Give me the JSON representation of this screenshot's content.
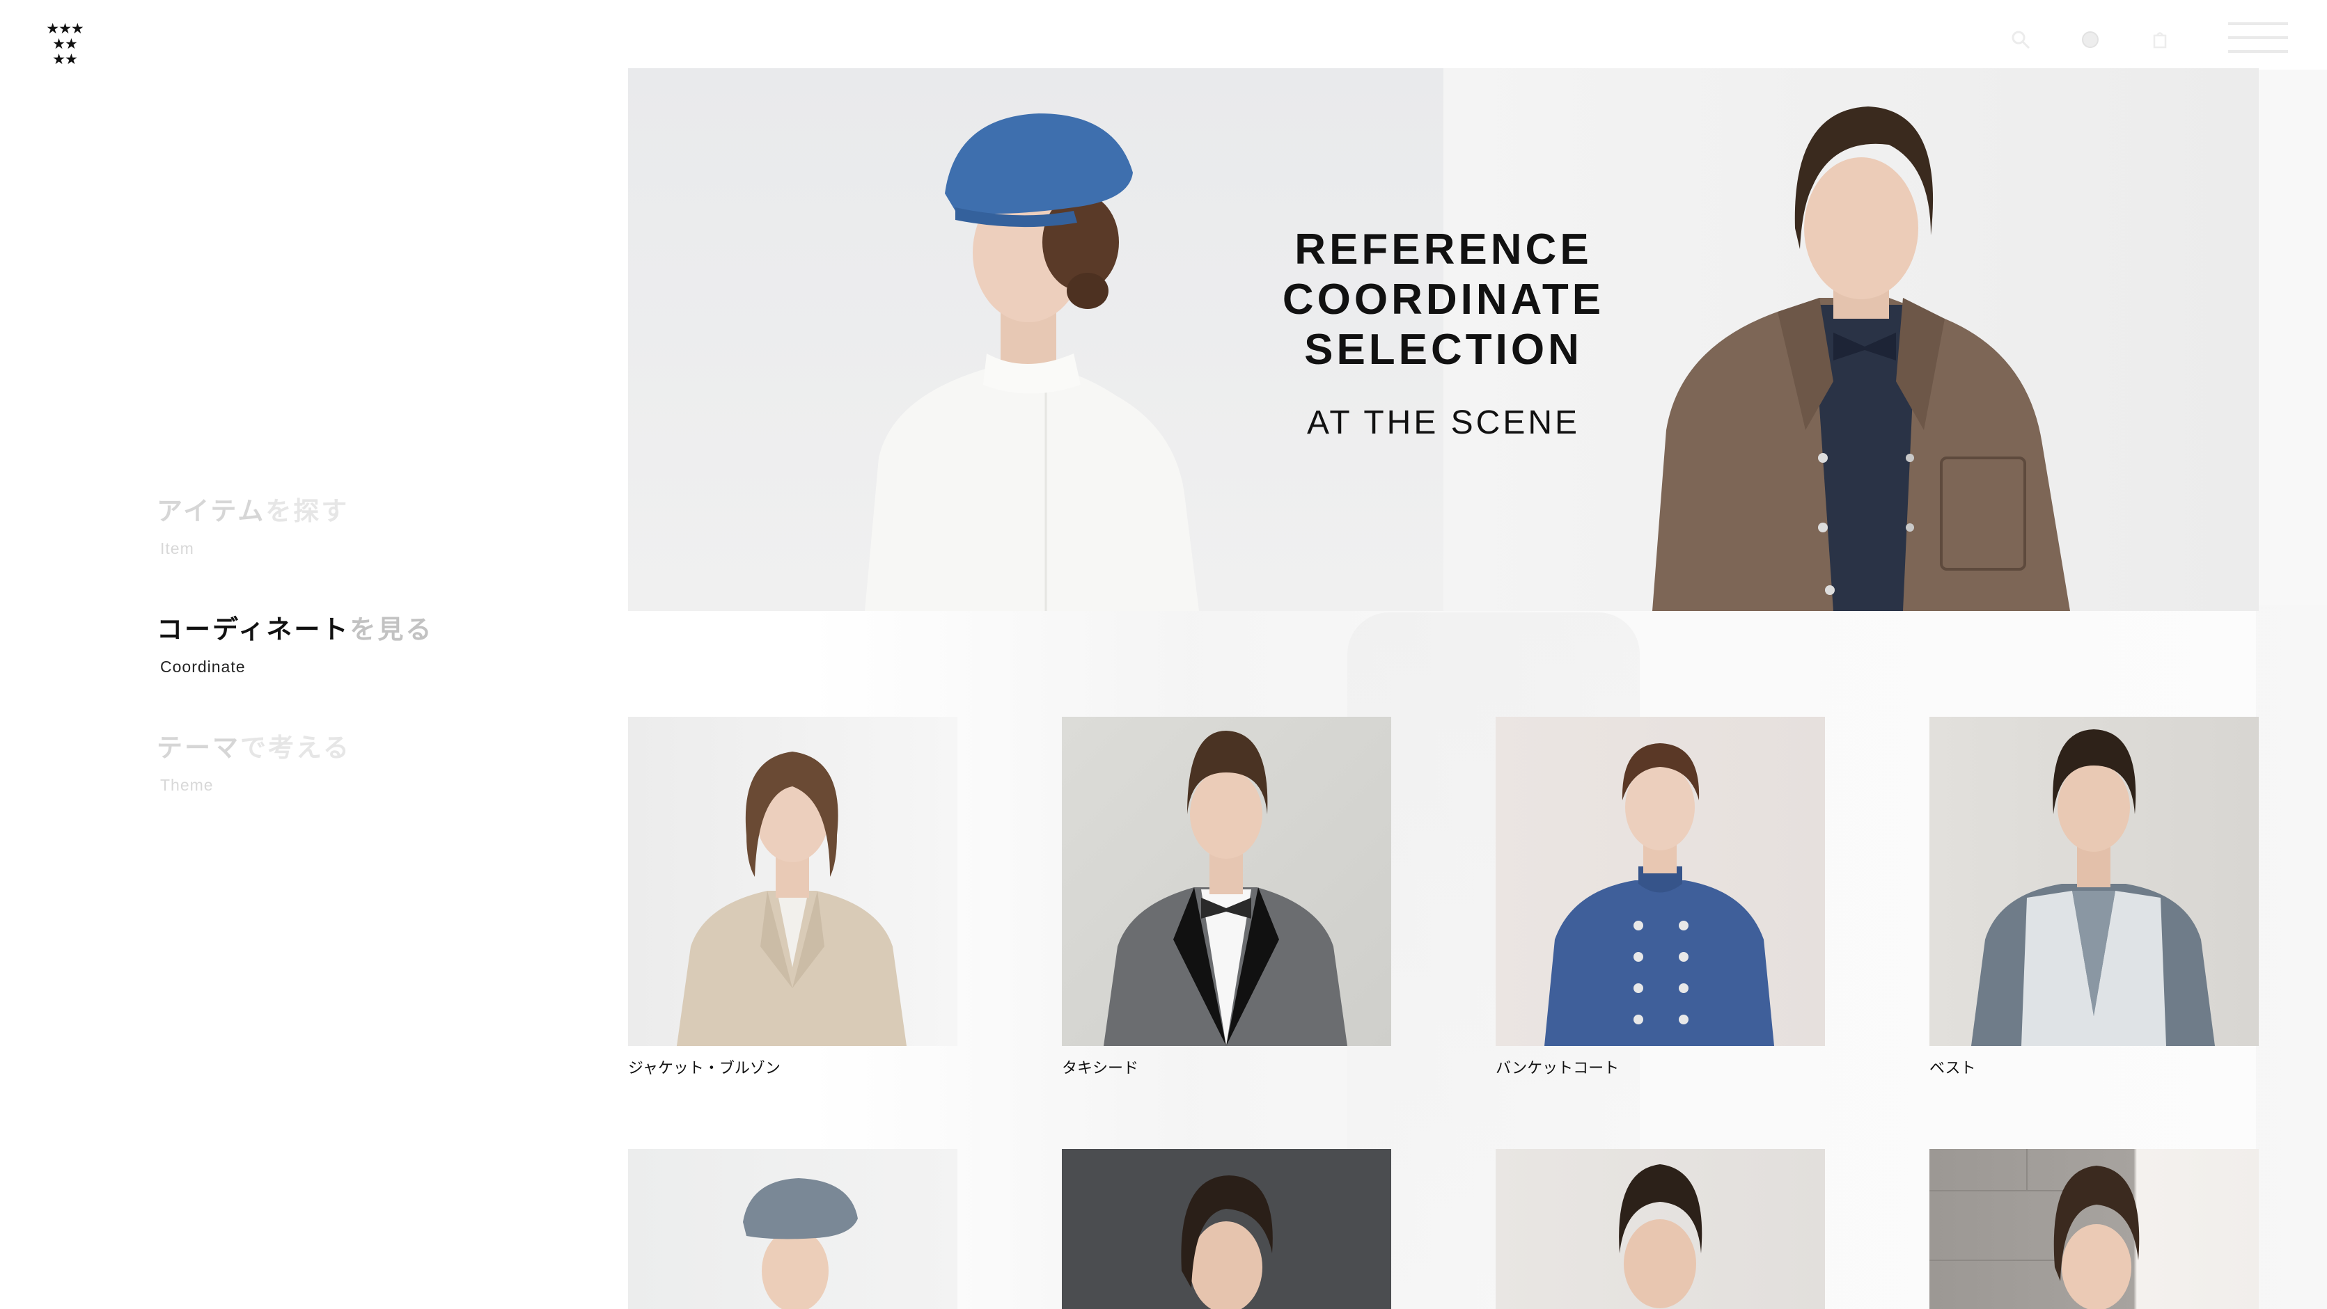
{
  "logo": {
    "rows": [
      "★★★",
      "★★",
      "★★"
    ]
  },
  "header": {
    "icons": [
      "search-icon",
      "globe-icon",
      "cart-icon",
      "menu-icon"
    ]
  },
  "side_nav": {
    "items": [
      {
        "jp_strong": "アイテム",
        "jp_weak": "を探す",
        "en": "Item",
        "state": "inactive"
      },
      {
        "jp_strong": "コーディネート",
        "jp_weak": "を見る",
        "en": "Coordinate",
        "state": "active"
      },
      {
        "jp_strong": "テーマ",
        "jp_weak": "で考える",
        "en": "Theme",
        "state": "inactive"
      }
    ]
  },
  "hero": {
    "title_lines": [
      "REFERENCE",
      "COORDINATE",
      "SELECTION"
    ],
    "subtitle": "AT THE SCENE"
  },
  "grid": {
    "row1": [
      {
        "caption": "ジャケット・ブルゾン"
      },
      {
        "caption": "タキシード"
      },
      {
        "caption": "バンケットコート"
      },
      {
        "caption": "ベスト"
      }
    ],
    "row2": [
      {
        "caption": ""
      },
      {
        "caption": ""
      },
      {
        "caption": ""
      },
      {
        "caption": ""
      }
    ]
  },
  "colors": {
    "text": "#111111",
    "inactive_nav": "#d6d6d6",
    "hero_beret": "#3e6fae",
    "banquet_coat": "#3f5f9a"
  }
}
